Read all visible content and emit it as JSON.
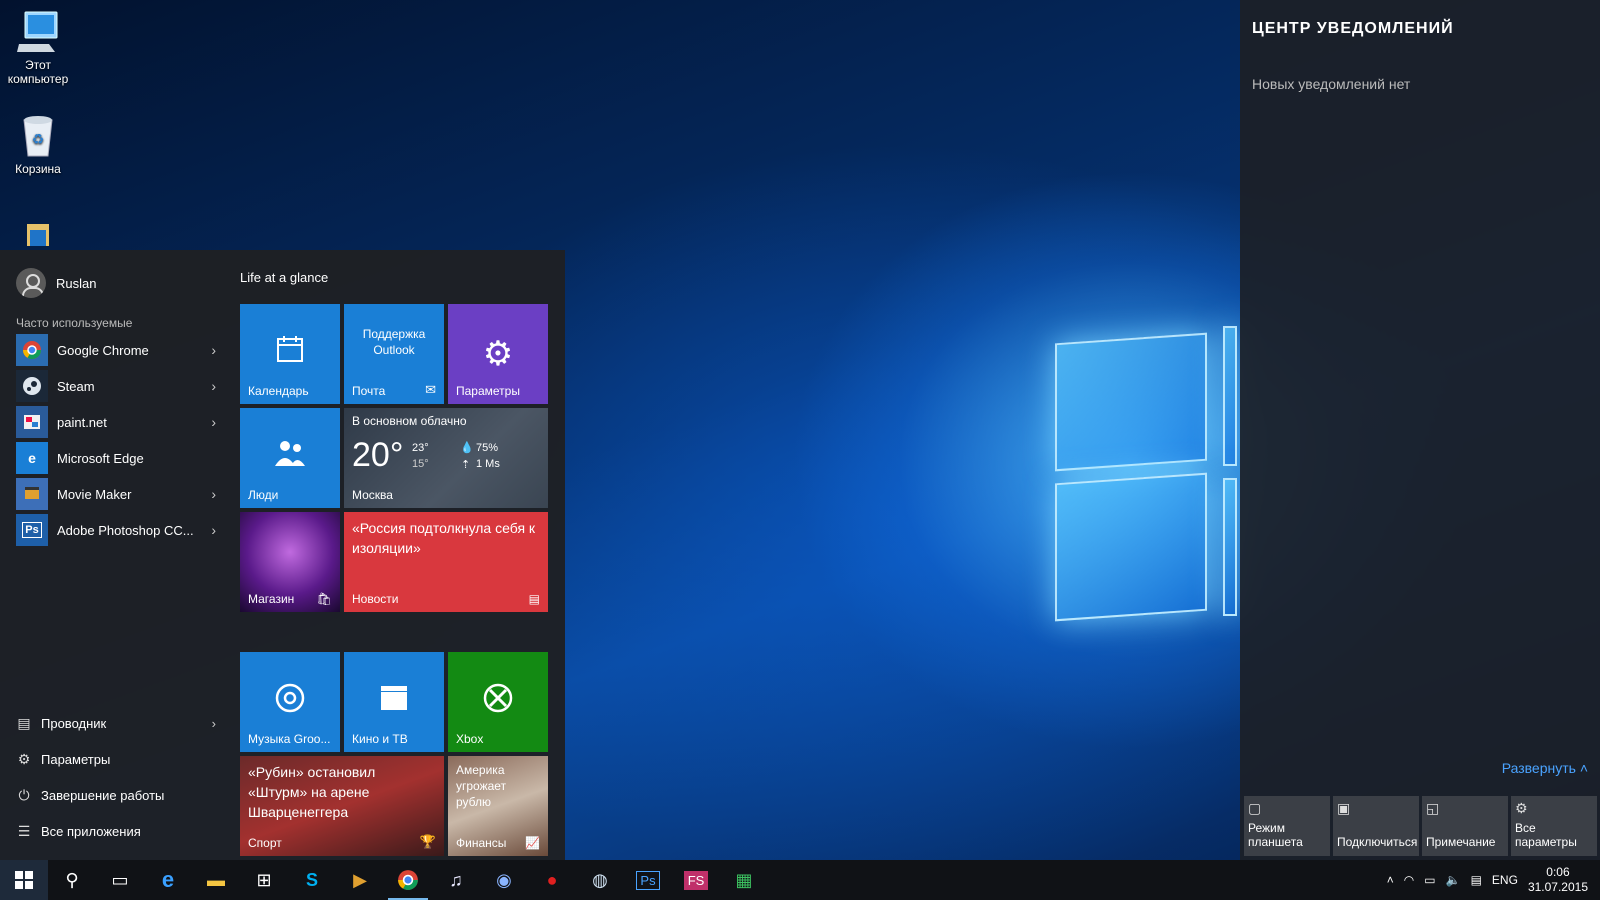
{
  "desktop": {
    "icons": [
      {
        "label_line1": "Этот",
        "label_line2": "компьютер",
        "icon": "computer-icon"
      },
      {
        "label_line1": "Корзина",
        "label_line2": "",
        "icon": "recycle-bin-icon"
      }
    ]
  },
  "start_menu": {
    "user": "Ruslan",
    "frequent_title": "Часто используемые",
    "apps": [
      {
        "label": "Google Chrome",
        "icon": "chrome-icon",
        "color": "#2b6cb0"
      },
      {
        "label": "Steam",
        "icon": "steam-icon",
        "color": "#1b2838"
      },
      {
        "label": "paint.net",
        "icon": "paintnet-icon",
        "color": "#2a5b9a"
      },
      {
        "label": "Microsoft Edge",
        "icon": "edge-icon",
        "color": "#1a7fd6"
      },
      {
        "label": "Movie Maker",
        "icon": "movie-maker-icon",
        "color": "#3d6fb8"
      },
      {
        "label": "Adobe Photoshop CC...",
        "icon": "photoshop-icon",
        "color": "#1e5fa8"
      }
    ],
    "bottom_items": [
      {
        "label": "Проводник",
        "icon": "explorer-icon"
      },
      {
        "label": "Параметры",
        "icon": "settings-icon"
      },
      {
        "label": "Завершение работы",
        "icon": "power-icon"
      },
      {
        "label": "Все приложения",
        "icon": "all-apps-icon"
      }
    ],
    "tiles_title": "Life at a glance",
    "tiles": {
      "calendar": "Календарь",
      "outlook_top": "Поддержка Outlook",
      "mail": "Почта",
      "settings": "Параметры",
      "people": "Люди",
      "weather": {
        "condition": "В основном облачно",
        "temp": "20°",
        "high": "23°",
        "low": "15°",
        "humidity": "75%",
        "wind": "1 Ms",
        "city": "Москва"
      },
      "store": "Магазин",
      "news_headline": "«Россия подтолкнула себя к изоляции»",
      "news": "Новости",
      "groove": "Музыка Groo...",
      "movies": "Кино и ТВ",
      "xbox": "Xbox",
      "sport_headline": "«Рубин» остановил «Штурм» на арене Шварценеггера",
      "sport": "Спорт",
      "finance_headline": "Америка угрожает рублю",
      "finance": "Финансы"
    }
  },
  "notification_center": {
    "title": "ЦЕНТР УВЕДОМЛЕНИЙ",
    "empty": "Новых уведомлений нет",
    "expand": "Развернуть",
    "quick_actions": [
      {
        "line1": "Режим",
        "line2": "планшета",
        "icon": "tablet-mode-icon"
      },
      {
        "line1": "",
        "line2": "Подключиться",
        "icon": "connect-icon"
      },
      {
        "line1": "",
        "line2": "Примечание",
        "icon": "note-icon"
      },
      {
        "line1": "Все",
        "line2": "параметры",
        "icon": "settings-icon"
      }
    ]
  },
  "taskbar": {
    "lang": "ENG",
    "time": "0:06",
    "date": "31.07.2015"
  }
}
